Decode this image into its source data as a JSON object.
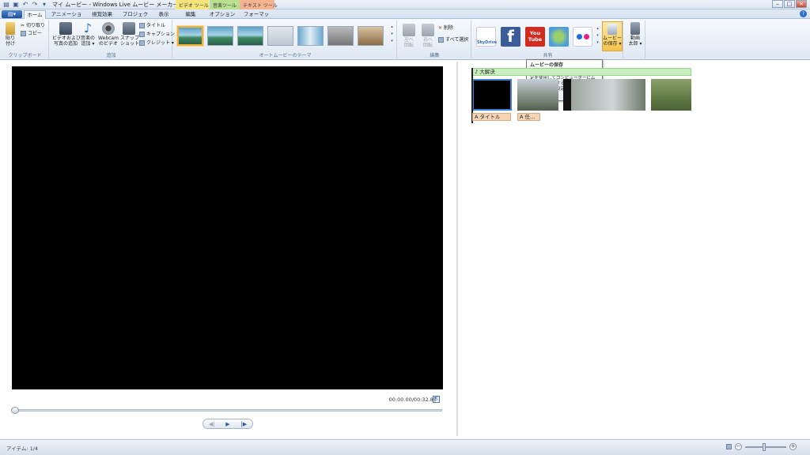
{
  "window": {
    "title": "マイ ムービー - Windows Live ムービー メーカー",
    "context_tabs": {
      "video": "ビデオ ツール",
      "music": "音楽ツール",
      "text": "テキスト ツール"
    }
  },
  "tabs": [
    "ホーム",
    "アニメーション",
    "視覚効果",
    "プロジェクト",
    "表示",
    "編集",
    "オプション",
    "フォーマット"
  ],
  "ribbon": {
    "clipboard": {
      "label": "クリップボード",
      "paste": "貼り\n付け",
      "cut": "切り取り",
      "copy": "コピー"
    },
    "add": {
      "label": "追加",
      "add_video": "ビデオおよび\n写真の追加",
      "add_music": "音楽の\n追加 ▾",
      "webcam": "Webcam\nのビデオ",
      "snapshot": "スナップ\nショット",
      "title": "タイトル",
      "caption": "キャプション",
      "credits": "クレジット ▾"
    },
    "themes": {
      "label": "オートムービーのテーマ"
    },
    "edit": {
      "label": "編集",
      "rotate_left": "左へ\n回転",
      "rotate_right": "右へ\n回転",
      "delete": "削除",
      "select_all": "すべて選択"
    },
    "share": {
      "label": "共有",
      "skydrive": "SkyDrive",
      "facebook": "f",
      "youtube": "You\nTube",
      "save_movie": "ムービー\nの保存 ▾",
      "upload": "動画\n太郎 ▾"
    }
  },
  "tooltip": {
    "title": "ムービーの保存",
    "body": "このプロジェクトに推奨される設定を使用してコンピューターにムービーを保存するか、矢印をクリックして他の設定を選択します。"
  },
  "player": {
    "timecode": "00:00.00/00:32.85"
  },
  "storyboard": {
    "music_label": "♪ 大解決",
    "captions": [
      "A タイトル",
      "A 任…"
    ]
  },
  "status": {
    "items": "アイテム: 1/4"
  },
  "colors": {
    "accent": "#3c7fd6",
    "selected_theme": "#f0b23c",
    "music_track": "#c9efc0",
    "caption_track": "#f6d4b5"
  }
}
